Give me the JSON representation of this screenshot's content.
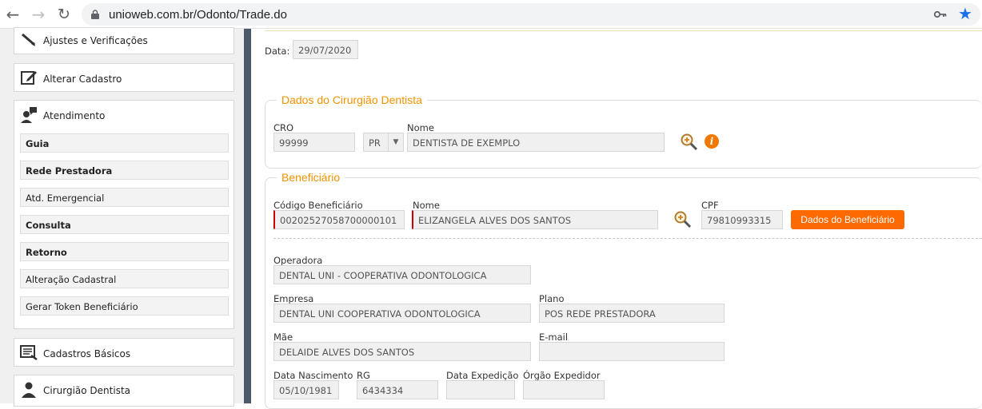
{
  "browser": {
    "url": "unioweb.com.br/Odonto/Trade.do"
  },
  "sidebar": {
    "top_items": [
      {
        "label": "Ajustes e Verificações",
        "icon": "tools-icon"
      },
      {
        "label": "Alterar Cadastro",
        "icon": "edit-icon"
      }
    ],
    "atendimento": {
      "label": "Atendimento",
      "icon": "user-chat-icon",
      "items": [
        {
          "label": "Guia",
          "bold": true
        },
        {
          "label": "Rede Prestadora",
          "bold": true
        },
        {
          "label": "Atd. Emergencial",
          "bold": false
        },
        {
          "label": "Consulta",
          "bold": true
        },
        {
          "label": "Retorno",
          "bold": true
        },
        {
          "label": "Alteração Cadastral",
          "bold": false
        },
        {
          "label": "Gerar Token Beneficiário",
          "bold": false
        }
      ]
    },
    "bottom_items": [
      {
        "label": "Cadastros Básicos",
        "icon": "register-icon"
      },
      {
        "label": "Cirurgião Dentista",
        "icon": "doctor-icon"
      }
    ]
  },
  "form": {
    "date_label": "Data:",
    "date_value": "29/07/2020",
    "dentist": {
      "legend": "Dados do Cirurgião Dentista",
      "cro_label": "CRO",
      "cro_value": "99999",
      "uf_value": "PR",
      "name_label": "Nome",
      "name_value": "DENTISTA DE EXEMPLO"
    },
    "beneficiary": {
      "legend": "Beneficiário",
      "code_label": "Código Beneficiário",
      "code_value": "0020252705870000010​1",
      "name_label": "Nome",
      "name_value": "ELIZANGELA ALVES DOS SANTOS",
      "cpf_label": "CPF",
      "cpf_value": "79810993315",
      "details_button": "Dados do Beneficiário",
      "operadora_label": "Operadora",
      "operadora_value": "DENTAL UNI - COOPERATIVA ODONTOLOGICA",
      "empresa_label": "Empresa",
      "empresa_value": "DENTAL UNI  COOPERATIVA ODONTOLOGICA",
      "plano_label": "Plano",
      "plano_value": "POS REDE PRESTADORA",
      "mae_label": "Mãe",
      "mae_value": "DELAIDE ALVES DOS SANTOS",
      "email_label": "E-mail",
      "email_value": "",
      "nascimento_label": "Data Nascimento",
      "nascimento_value": "05/10/1981",
      "rg_label": "RG",
      "rg_value": "6434334",
      "expedicao_label": "Data Expedição",
      "expedicao_value": "",
      "orgao_label": "Órgão Expedidor",
      "orgao_value": ""
    }
  },
  "colors": {
    "accent": "#f29300",
    "button": "#ff6a00",
    "sidebar_strip": "#4b5a6b"
  }
}
